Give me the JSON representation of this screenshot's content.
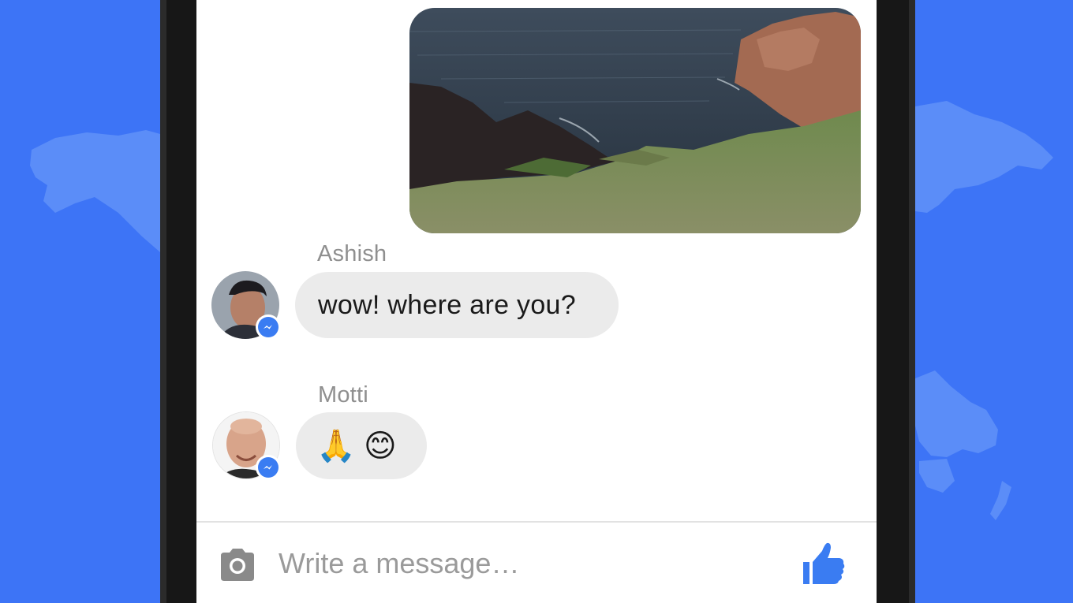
{
  "conversation": {
    "photo_message": {
      "alt": "coastal cliff photo",
      "icon": "photo"
    },
    "messages": [
      {
        "sender": "Ashish",
        "text": "wow! where are you?"
      },
      {
        "sender": "Motti",
        "emojis": [
          "🙏",
          "😊"
        ]
      }
    ],
    "badge_icon": "messenger-icon"
  },
  "composer": {
    "placeholder": "Write a message…",
    "camera_icon": "camera-icon",
    "like_icon": "thumbs-up-icon"
  },
  "colors": {
    "background": "#3d74f6",
    "accent": "#3a7cf2",
    "bubble": "#ebebeb",
    "sender_name": "#8f8f8f"
  }
}
